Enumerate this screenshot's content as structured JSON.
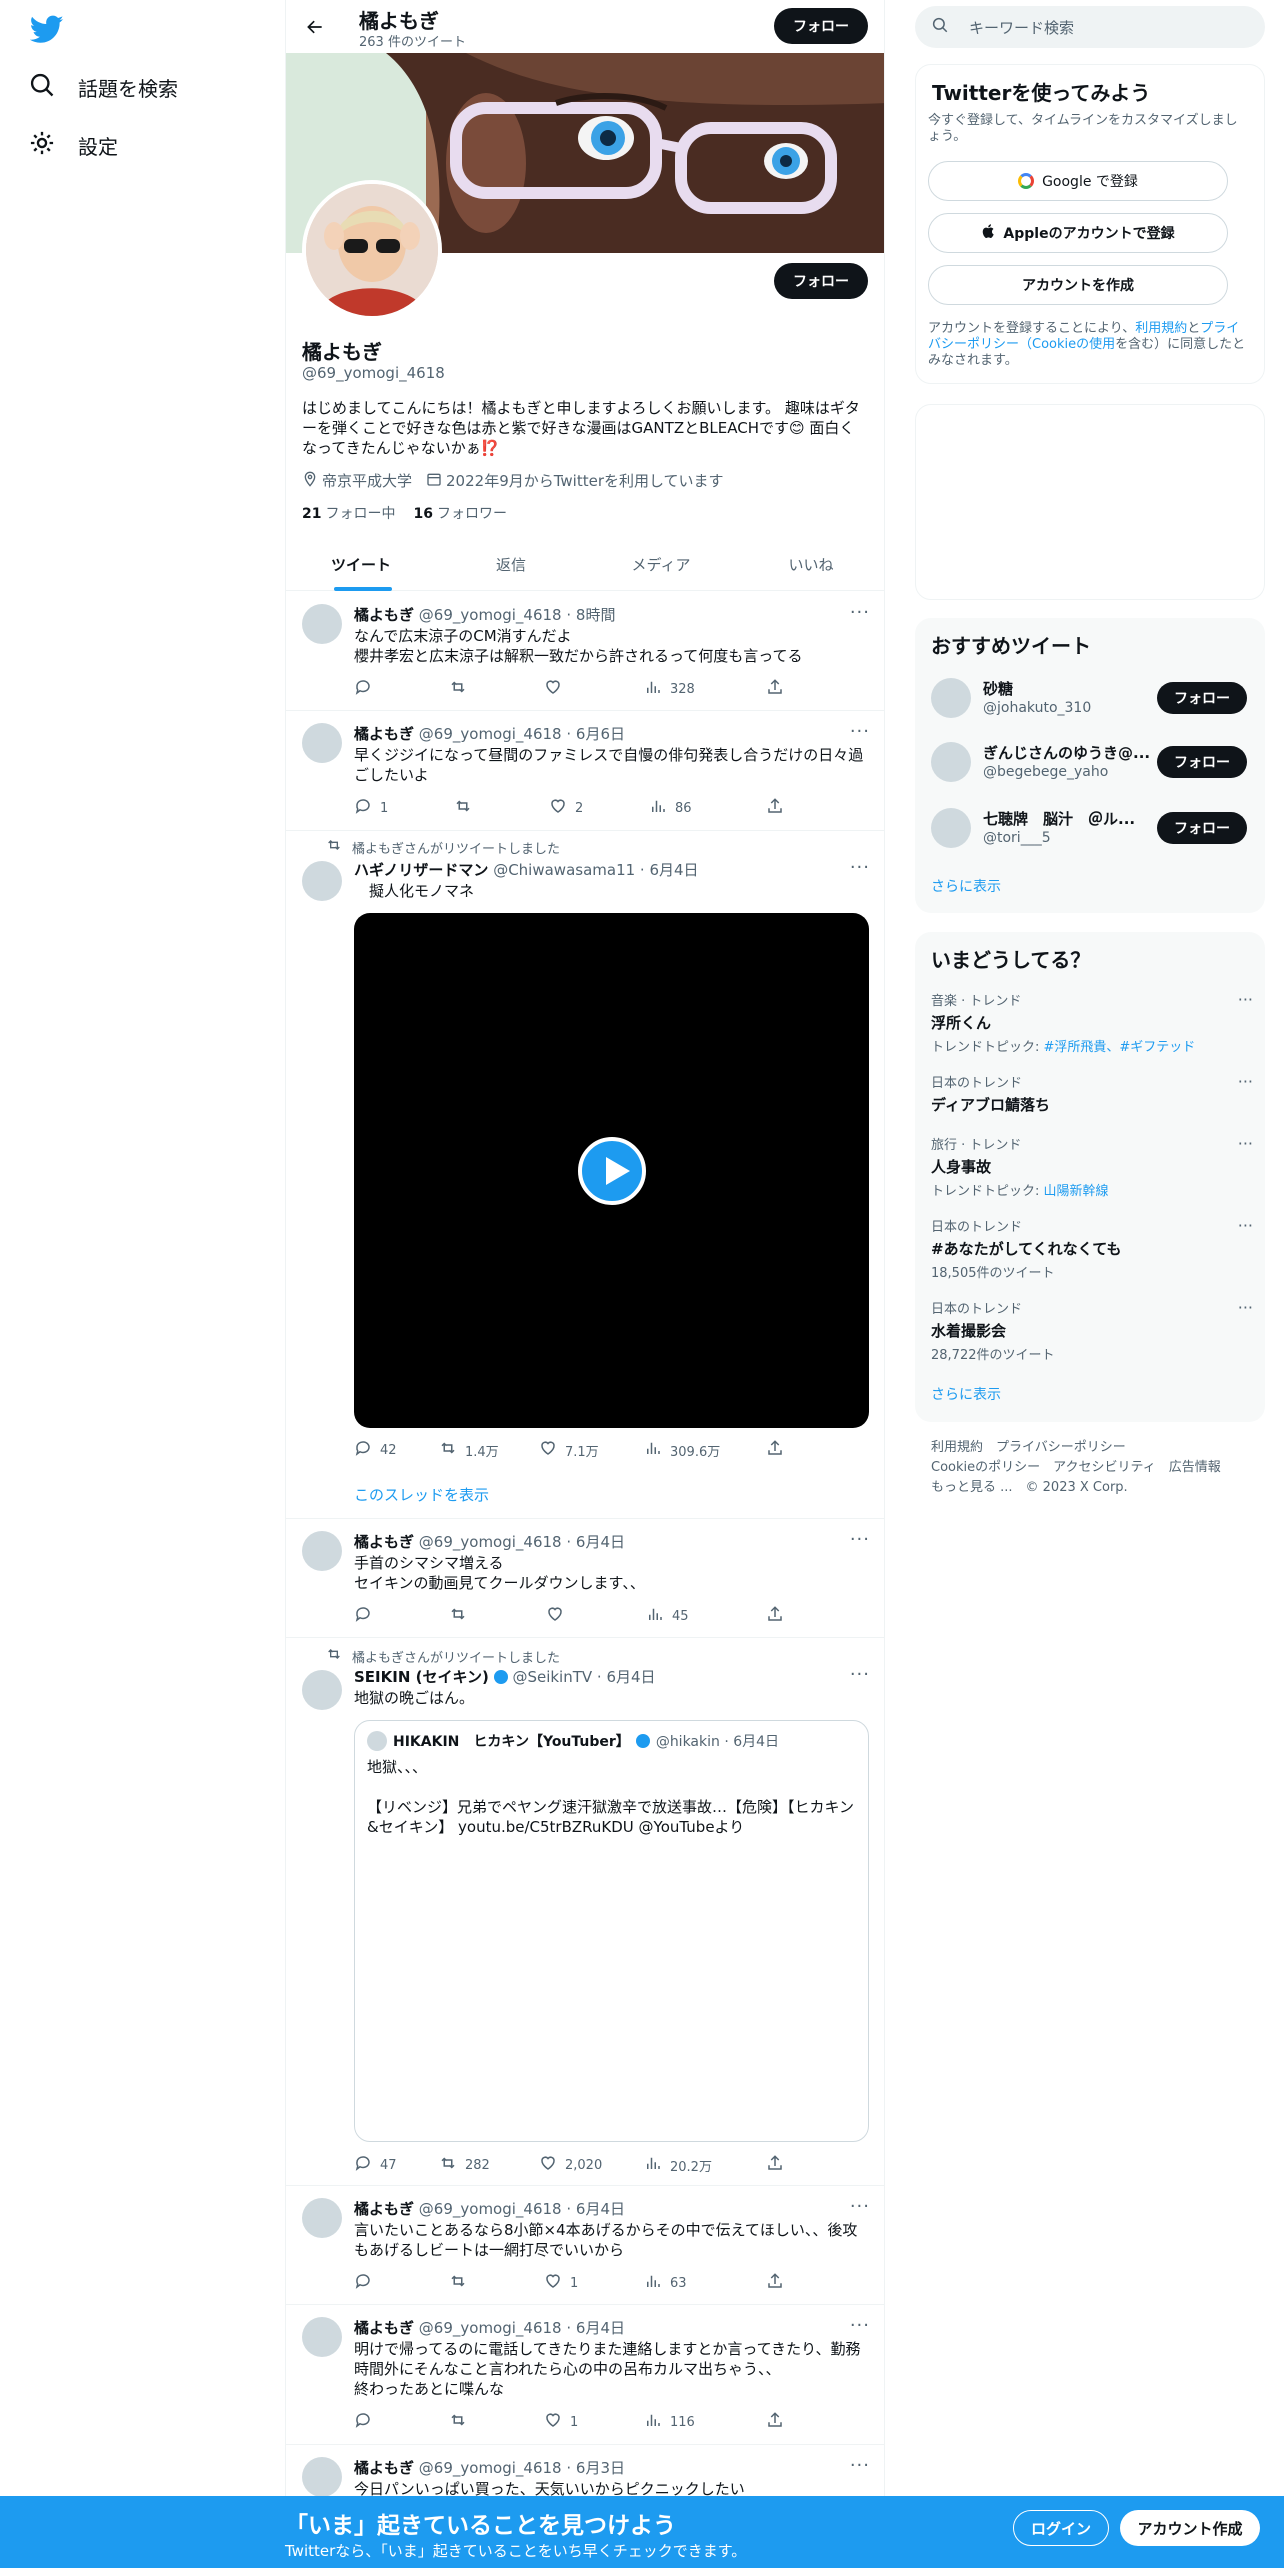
{
  "nav": {
    "explore": "話題を検索",
    "settings": "設定"
  },
  "header": {
    "name": "橘よもぎ",
    "tweet_count": "263 件のツイート",
    "follow": "フォロー"
  },
  "profile": {
    "name": "橘よもぎ",
    "handle": "@69_yomogi_4618",
    "follow": "フォロー",
    "bio": "はじめましてこんにちは！橘よもぎと申しますよろしくお願いします。 趣味はギターを弾くことで好きな色は赤と紫で好きな漫画はGANTZとBLEACHです😊 面白くなってきたんじゃないかぁ⁉️",
    "location": "帝京平成大学",
    "joined": "2022年9月からTwitterを利用しています",
    "following_count": "21",
    "following_label": "フォロー中",
    "followers_count": "16",
    "followers_label": "フォロワー"
  },
  "tabs": [
    "ツイート",
    "返信",
    "メディア",
    "いいね"
  ],
  "tweets": [
    {
      "name": "橘よもぎ",
      "meta": "@69_yomogi_4618 · 8時間",
      "text": "なんで広末涼子のCM消すんだよ\n櫻井孝宏と広末涼子は解釈一致だから許されるって何度も言ってる",
      "reply": "",
      "rt": "",
      "like": "",
      "views": "328"
    },
    {
      "name": "橘よもぎ",
      "meta": "@69_yomogi_4618 · 6月6日",
      "text": "早くジジイになって昼間のファミレスで自慢の俳句発表し合うだけの日々過ごしたいよ",
      "reply": "1",
      "rt": "",
      "like": "2",
      "views": "86"
    },
    {
      "rt_label": "橘よもぎさんがリツイートしました",
      "name": "ハギノリザードマン",
      "meta": "@Chiwawasama11 · 6月4日",
      "text": "　擬人化モノマネ",
      "reply": "42",
      "rt": "1.4万",
      "like": "7.1万",
      "views": "309.6万",
      "thread": "このスレッドを表示"
    },
    {
      "name": "橘よもぎ",
      "meta": "@69_yomogi_4618 · 6月4日",
      "text": "手首のシマシマ増える\nセイキンの動画見てクールダウンします、、",
      "reply": "",
      "rt": "",
      "like": "",
      "views": "45"
    },
    {
      "rt_label": "橘よもぎさんがリツイートしました",
      "name": "SEIKIN (セイキン)",
      "meta": "@SeikinTV · 6月4日",
      "text": "地獄の晩ごはん。",
      "quote_name": "HIKAKIN　ヒカキン【YouTuber】",
      "quote_meta": "@hikakin · 6月4日",
      "quote_text": "地獄、、、\n\n【リベンジ】兄弟でペヤング速汗獄激辛で放送事故…【危険】【ヒカキン&セイキン】 youtu.be/C5trBZRuKDU @YouTubeより",
      "reply": "47",
      "rt": "282",
      "like": "2,020",
      "views": "20.2万"
    },
    {
      "name": "橘よもぎ",
      "meta": "@69_yomogi_4618 · 6月4日",
      "text": "言いたいことあるなら8小節×4本あげるからその中で伝えてほしい、、後攻もあげるしビートは一網打尽でいいから",
      "reply": "",
      "rt": "",
      "like": "1",
      "views": "63"
    },
    {
      "name": "橘よもぎ",
      "meta": "@69_yomogi_4618 · 6月4日",
      "text": "明けで帰ってるのに電話してきたりまた連絡しますとか言ってきたり、勤務時間外にそんなこと言われたら心の中の呂布カルマ出ちゃう、、\n終わったあとに喋んな",
      "reply": "",
      "rt": "",
      "like": "1",
      "views": "116"
    },
    {
      "name": "橘よもぎ",
      "meta": "@69_yomogi_4618 · 6月3日",
      "text": "今日パンいっぱい買った、天気いいからピクニックしたい"
    }
  ],
  "right": {
    "search_placeholder": "キーワード検索",
    "signup": {
      "title": "Twitterを使ってみよう",
      "desc": "今すぐ登録して、タイムラインをカスタマイズしましょう。",
      "google": "Google で登録",
      "apple": "Appleのアカウントで登録",
      "create": "アカウントを作成",
      "terms_pre": "アカウントを登録することにより、",
      "terms_link": "利用規約",
      "terms_mid": "と",
      "privacy_link": "プライバシーポリシー（Cookieの使用",
      "terms_post": "を含む）に同意したとみなされます。"
    },
    "recommend": {
      "title": "おすすめツイート",
      "users": [
        {
          "name": "砂糖",
          "handle": "@johakuto_310",
          "btn": "フォロー"
        },
        {
          "name": "ぎんじさんのゆうき@...",
          "handle": "@begebege_yaho",
          "btn": "フォロー"
        },
        {
          "name": "七聴牌　脳汁　＠ル...",
          "handle": "@tori___5",
          "btn": "フォロー"
        }
      ],
      "more": "さらに表示"
    },
    "trends": {
      "title": "いまどうしてる？",
      "items": [
        {
          "cat": "音楽 · トレンド",
          "title": "浮所くん",
          "sub_pre": "トレンドトピック: ",
          "sub_link": "#浮所飛貴、#ギフテッド"
        },
        {
          "cat": "日本のトレンド",
          "title": "ディアブロ鯖落ち"
        },
        {
          "cat": "旅行 · トレンド",
          "title": "人身事故",
          "sub_pre": "トレンドトピック: ",
          "sub_link": "山陽新幹線"
        },
        {
          "cat": "日本のトレンド",
          "title": "#あなたがしてくれなくても",
          "sub": "18,505件のツイート"
        },
        {
          "cat": "日本のトレンド",
          "title": "水着撮影会",
          "sub": "28,722件のツイート"
        }
      ],
      "more": "さらに表示"
    },
    "footer": {
      "line1": "利用規約　プライバシーポリシー",
      "line2": "Cookieのポリシー　アクセシビリティ　広告情報",
      "line3": "もっと見る ...　© 2023 X Corp."
    }
  },
  "bottom": {
    "title": "「いま」起きていることを見つけよう",
    "sub": "Twitterなら、「いま」起きていることをいち早くチェックできます。",
    "login": "ログイン",
    "signup": "アカウント作成"
  }
}
